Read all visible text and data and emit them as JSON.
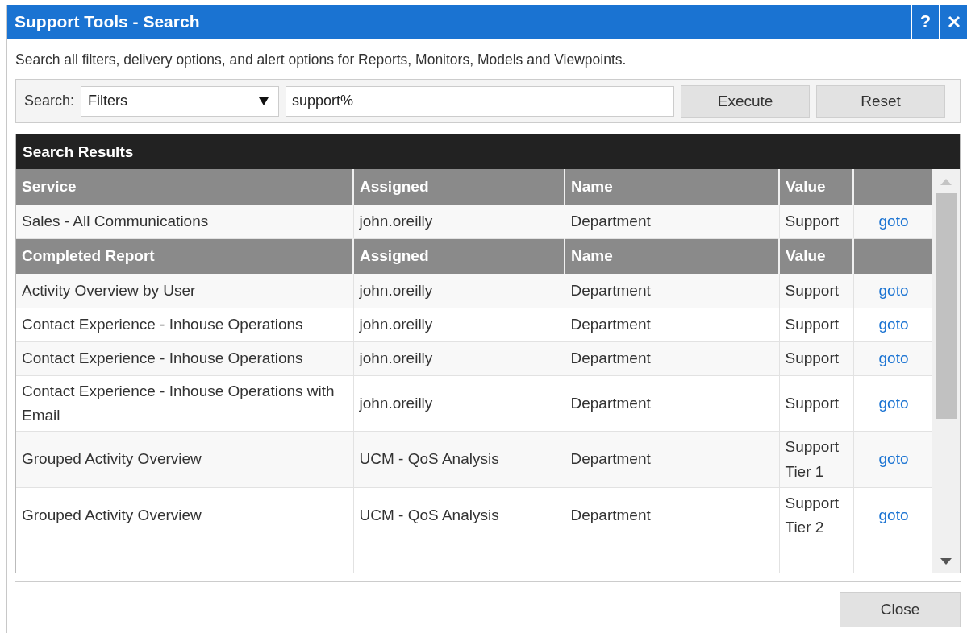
{
  "window": {
    "title": "Support Tools - Search",
    "help": "?"
  },
  "description": "Search all filters, delivery options, and alert options for Reports, Monitors, Models and Viewpoints.",
  "search": {
    "label": "Search:",
    "type": "Filters",
    "query": "support%",
    "buttons": [
      "Execute",
      "Reset"
    ]
  },
  "results": {
    "title": "Search Results",
    "sections": [
      {
        "columns": [
          "Service",
          "Assigned",
          "Name",
          "Value"
        ],
        "rows": [
          {
            "cells": [
              "Sales - All Communications",
              "john.oreilly",
              "Department",
              "Support"
            ],
            "link": "goto"
          }
        ]
      },
      {
        "columns": [
          "Completed Report",
          "Assigned",
          "Name",
          "Value"
        ],
        "rows": [
          {
            "cells": [
              "Activity Overview by User",
              "john.oreilly",
              "Department",
              "Support"
            ],
            "link": "goto"
          },
          {
            "cells": [
              "Contact Experience - Inhouse Operations",
              "john.oreilly",
              "Department",
              "Support"
            ],
            "link": "goto"
          },
          {
            "cells": [
              "Contact Experience - Inhouse Operations",
              "john.oreilly",
              "Department",
              "Support"
            ],
            "link": "goto"
          },
          {
            "cells": [
              "Contact Experience - Inhouse Operations with Email",
              "john.oreilly",
              "Department",
              "Support"
            ],
            "link": "goto"
          },
          {
            "cells": [
              "Grouped Activity Overview",
              "UCM - QoS Analysis",
              "Department",
              "Support Tier 1"
            ],
            "link": "goto"
          },
          {
            "cells": [
              "Grouped Activity Overview",
              "UCM - QoS Analysis",
              "Department",
              "Support Tier 2"
            ],
            "link": "goto"
          }
        ]
      }
    ]
  },
  "footer": {
    "button": "Close"
  }
}
